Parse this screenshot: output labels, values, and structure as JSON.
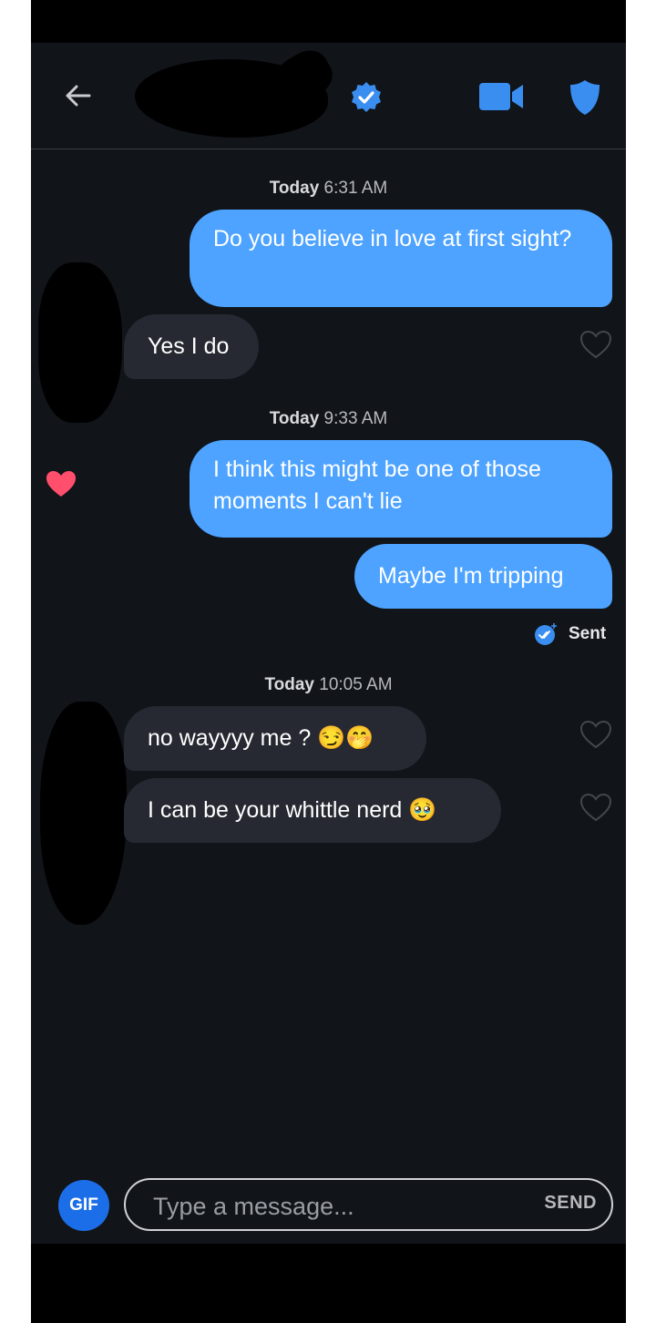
{
  "header": {
    "contact_name": "",
    "verified": true,
    "icons": [
      "back-arrow-icon",
      "verified-badge-icon",
      "video-call-icon",
      "safety-shield-icon"
    ]
  },
  "colors": {
    "background": "#111419",
    "outgoing_bubble": "#4da3ff",
    "incoming_bubble": "#262932",
    "accent": "#1c6ee8",
    "like_heart": "#ff4f6d"
  },
  "messages": [
    {
      "type": "timestamp",
      "day": "Today",
      "time": "6:31 AM"
    },
    {
      "type": "outgoing",
      "text": "Do you believe in love at first sight?"
    },
    {
      "type": "incoming",
      "text": "Yes I do"
    },
    {
      "type": "timestamp",
      "day": "Today",
      "time": "9:33 AM"
    },
    {
      "type": "outgoing",
      "text": "I think this might be one of those moments I can't lie",
      "liked": true
    },
    {
      "type": "outgoing",
      "text": "Maybe I'm tripping"
    },
    {
      "type": "status",
      "text": "Sent"
    },
    {
      "type": "timestamp",
      "day": "Today",
      "time": "10:05 AM"
    },
    {
      "type": "incoming",
      "text": "no wayyyy me ? 😏🤭"
    },
    {
      "type": "incoming",
      "text": "I can be your whittle nerd 🥹"
    }
  ],
  "composer": {
    "gif_label": "GIF",
    "placeholder": "Type a message...",
    "send_label": "SEND"
  }
}
